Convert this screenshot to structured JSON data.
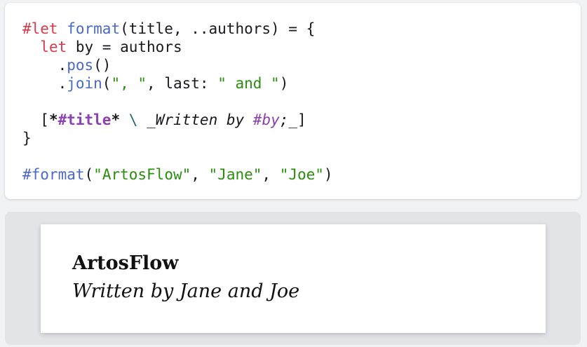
{
  "code": {
    "line1": {
      "t1": "#let",
      "t2": " ",
      "t3": "format",
      "t4": "(title, ..authors) = {"
    },
    "line2": {
      "t1": "  ",
      "t2": "let",
      "t3": " by = authors"
    },
    "line3": {
      "t1": "    .",
      "t2": "pos",
      "t3": "()"
    },
    "line4": {
      "t1": "    .",
      "t2": "join",
      "t3": "(",
      "t4": "\", \"",
      "t5": ", last: ",
      "t6": "\" and \"",
      "t7": ")"
    },
    "line6": {
      "t1": "  [",
      "t2": "*",
      "t3": "#title",
      "t4": "*",
      "t5": " ",
      "t6": "\\",
      "t7": " _",
      "t8": "Written by ",
      "t9": "#by",
      "t10": ";",
      "t11": "_]"
    },
    "line7": {
      "t1": "}"
    },
    "line9": {
      "t1": "#format",
      "t2": "(",
      "t3": "\"ArtosFlow\"",
      "t4": ", ",
      "t5": "\"Jane\"",
      "t6": ", ",
      "t7": "\"Joe\"",
      "t8": ")"
    }
  },
  "preview": {
    "title": "ArtosFlow",
    "byline": "Written by Jane and Joe"
  },
  "colors": {
    "keyword": "#d73a49",
    "function": "#4b69c6",
    "string": "#298e0d",
    "markup": "#8b41b1"
  }
}
